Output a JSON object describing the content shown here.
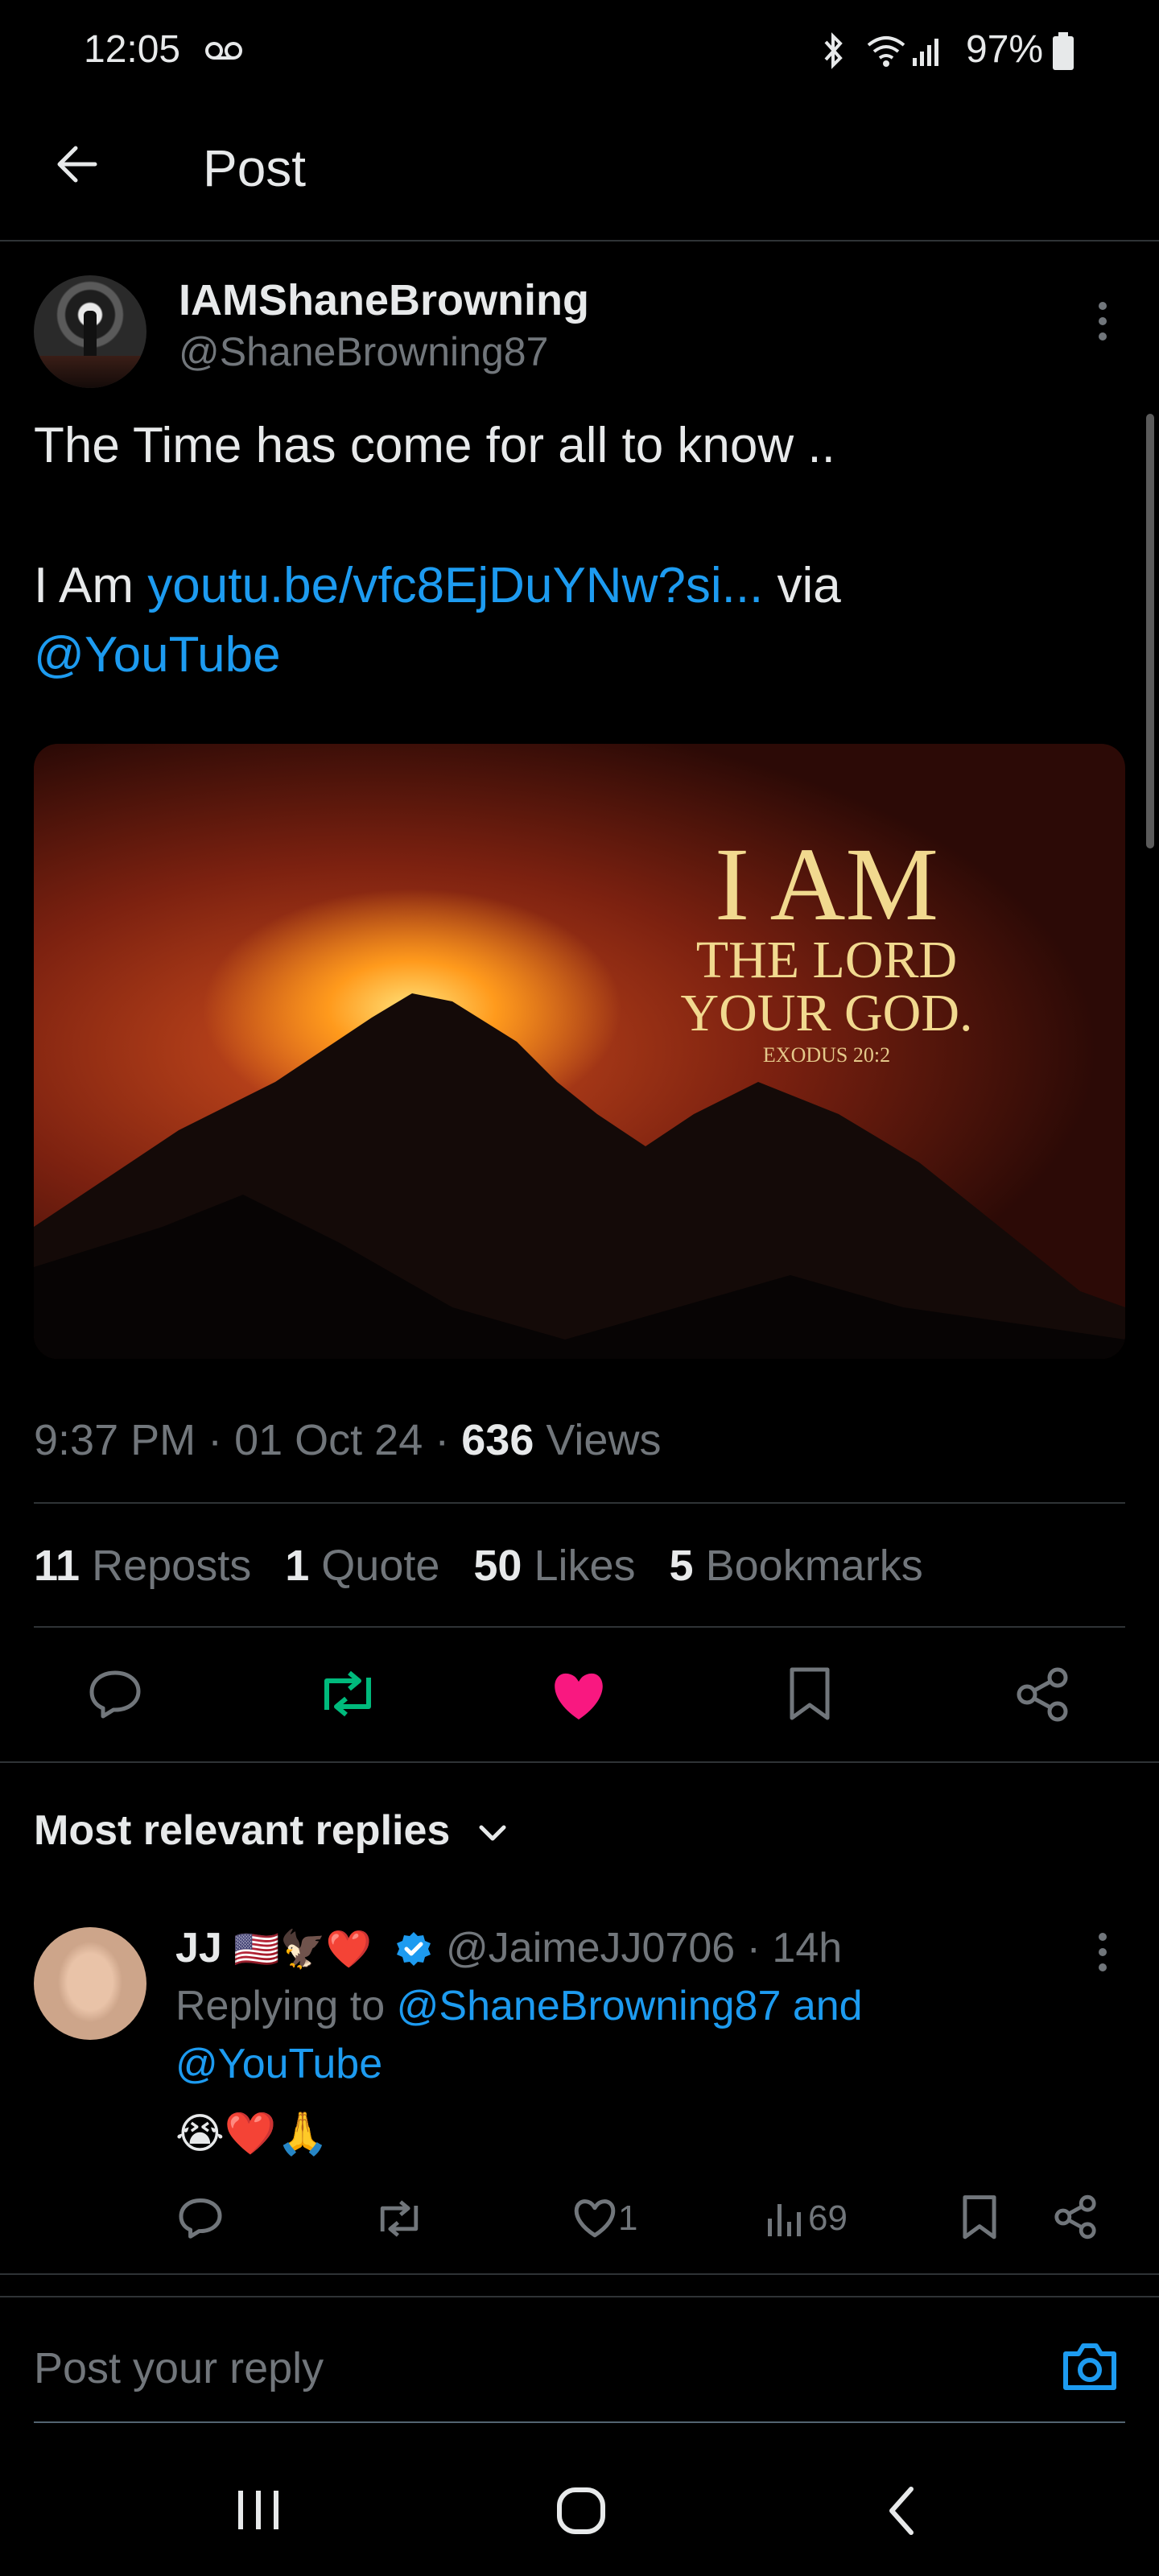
{
  "status_bar": {
    "time": "12:05",
    "battery": "97%",
    "icons": [
      "voicemail-icon",
      "bluetooth-icon",
      "wifi-icon",
      "signal-icon",
      "battery-icon"
    ]
  },
  "header": {
    "title": "Post"
  },
  "post": {
    "author_name": "IAMShaneBrowning",
    "author_handle": "@ShaneBrowning87",
    "text_line1": "The Time has come for all to know ..",
    "text_prefix": "I Am ",
    "link": "youtu.be/vfc8EjDuYNw?si...",
    "text_via": " via",
    "mention": "@YouTube",
    "image_text": {
      "big": "I AM",
      "line2": "THE LORD",
      "line3": "YOUR GOD.",
      "ref": "EXODUS 20:2"
    },
    "time": "9:37 PM",
    "date": "01 Oct 24",
    "views": "636",
    "views_label": "Views",
    "stats": [
      {
        "count": "11",
        "label": "Reposts"
      },
      {
        "count": "1",
        "label": "Quote"
      },
      {
        "count": "50",
        "label": "Likes"
      },
      {
        "count": "5",
        "label": "Bookmarks"
      }
    ]
  },
  "replies_section": {
    "title": "Most relevant replies"
  },
  "reply": {
    "name": "JJ",
    "emoji": "🇺🇸🦅❤️",
    "handle": "@JaimeJJ0706",
    "age": "14h",
    "replying_prefix": "Replying to ",
    "replying_to_1": "@ShaneBrowning87 and",
    "replying_to_2": "@YouTube",
    "body": "😭❤️🙏",
    "likes": "1",
    "views": "69"
  },
  "compose": {
    "placeholder": "Post your reply"
  },
  "colors": {
    "accent": "#1d9bf0",
    "like": "#f91880",
    "repost": "#00ba7c",
    "background": "#000000"
  }
}
